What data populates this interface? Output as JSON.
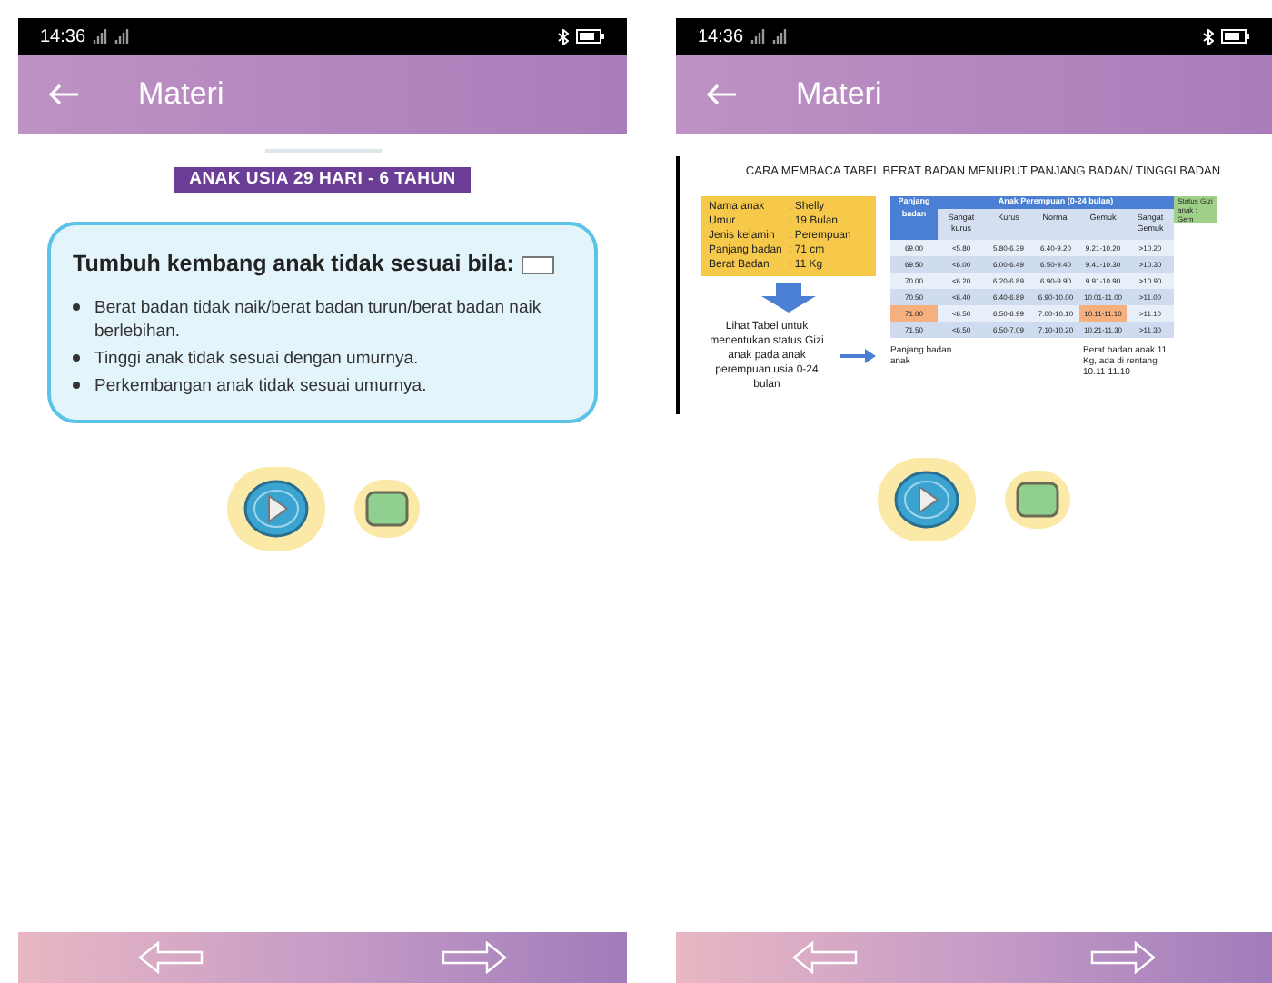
{
  "phones": [
    {
      "status_time": "14:36",
      "title": "Materi",
      "content": {
        "kind": "card",
        "banner": "ANAK USIA 29 HARI - 6 TAHUN",
        "heading": "Tumbuh kembang anak tidak sesuai bila:",
        "bullets": [
          "Berat badan tidak naik/berat badan turun/berat badan naik berlebihan.",
          "Tinggi anak tidak sesuai dengan umurnya.",
          "Perkembangan anak tidak sesuai umurnya."
        ]
      }
    },
    {
      "status_time": "14:36",
      "title": "Materi",
      "content": {
        "kind": "infographic",
        "heading": "CARA MEMBACA TABEL BERAT BADAN MENURUT PANJANG BADAN/ TINGGI BADAN",
        "profile": [
          {
            "label": "Nama anak",
            "value": ": Shelly"
          },
          {
            "label": "Umur",
            "value": ": 19 Bulan"
          },
          {
            "label": "Jenis kelamin",
            "value": ": Perempuan"
          },
          {
            "label": "Panjang badan",
            "value": ": 71 cm"
          },
          {
            "label": "Berat Badan",
            "value": ": 11 Kg"
          }
        ],
        "instruction": "Lihat Tabel untuk menentukan status Gizi anak pada anak perempuan usia 0-24 bulan",
        "table": {
          "group": "Anak Perempuan (0-24 bulan)",
          "columns": [
            "Panjang badan",
            "Sangat kurus",
            "Kurus",
            "Normal",
            "Gemuk",
            "Sangat Gemuk"
          ],
          "rows": [
            {
              "cells": [
                "69.00",
                "<5.80",
                "5.80-6.39",
                "6.40-9.20",
                "9.21-10.20",
                ">10.20"
              ],
              "selected": false
            },
            {
              "cells": [
                "69.50",
                "<6.00",
                "6.00-6.49",
                "6.50-9.40",
                "9.41-10.30",
                ">10.30"
              ],
              "selected": false
            },
            {
              "cells": [
                "70.00",
                "<6.20",
                "6.20-6.89",
                "6.90-9.90",
                "9.91-10.90",
                ">10.90"
              ],
              "selected": false
            },
            {
              "cells": [
                "70.50",
                "<6.40",
                "6.40-6.89",
                "6.90-10.00",
                "10.01-11.00",
                ">11.00"
              ],
              "selected": false
            },
            {
              "cells": [
                "71.00",
                "<6.50",
                "6.50-6.99",
                "7.00-10.10",
                "10.11-11.10",
                ">11.10"
              ],
              "selected": true
            },
            {
              "cells": [
                "71.50",
                "<6.50",
                "6.50-7.09",
                "7.10-10.20",
                "10.21-11.30",
                ">11.30"
              ],
              "selected": false
            }
          ]
        },
        "note_status": "Status Gizi anak : Gem",
        "note_length": "Panjang badan anak",
        "note_weight": "Berat badan anak 11 Kg, ada di rentang 10.11-11.10"
      }
    }
  ]
}
